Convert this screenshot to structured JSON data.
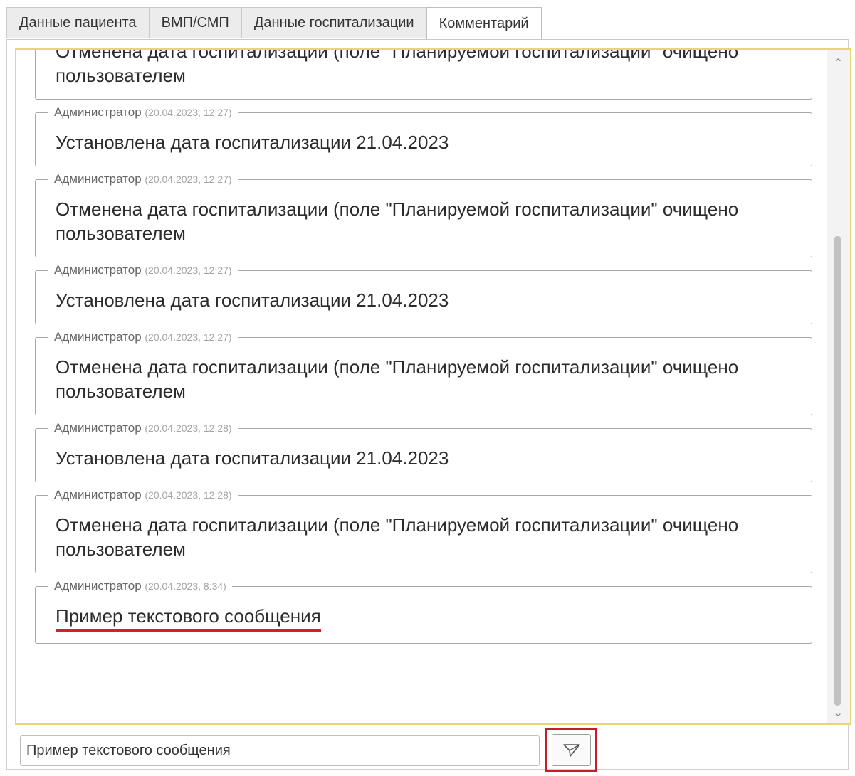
{
  "tabs": [
    {
      "label": "Данные пациента",
      "active": false
    },
    {
      "label": "ВМП/СМП",
      "active": false
    },
    {
      "label": "Данные госпитализации",
      "active": false
    },
    {
      "label": "Комментарий",
      "active": true
    }
  ],
  "log": {
    "entries": [
      {
        "author": "",
        "time": "",
        "text": "Отменена дата госпитализации (поле \"Планируемой госпитализации\" очищено пользователем"
      },
      {
        "author": "Администратор",
        "time": "(20.04.2023, 12:27)",
        "text": "Установлена дата госпитализации 21.04.2023"
      },
      {
        "author": "Администратор",
        "time": "(20.04.2023, 12:27)",
        "text": "Отменена дата госпитализации (поле \"Планируемой госпитализации\" очищено пользователем"
      },
      {
        "author": "Администратор",
        "time": "(20.04.2023, 12:27)",
        "text": "Установлена дата госпитализации 21.04.2023"
      },
      {
        "author": "Администратор",
        "time": "(20.04.2023, 12:27)",
        "text": "Отменена дата госпитализации (поле \"Планируемой госпитализации\" очищено пользователем"
      },
      {
        "author": "Администратор",
        "time": "(20.04.2023, 12:28)",
        "text": "Установлена дата госпитализации 21.04.2023"
      },
      {
        "author": "Администратор",
        "time": "(20.04.2023, 12:28)",
        "text": "Отменена дата госпитализации (поле \"Планируемой госпитализации\" очищено пользователем"
      },
      {
        "author": "Администратор",
        "time": "(20.04.2023, 8:34)",
        "text": "Пример текстового сообщения"
      }
    ]
  },
  "composer": {
    "value": "Пример текстового сообщения",
    "send_icon": "send-icon"
  },
  "colors": {
    "highlight": "#c21f2b",
    "panel_border": "#e6d770"
  }
}
